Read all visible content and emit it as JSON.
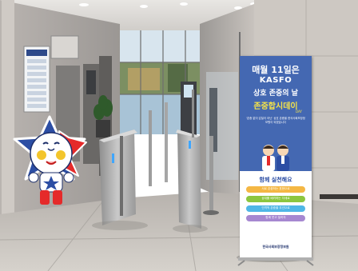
{
  "banner": {
    "line1": "매월 11일은",
    "brand": "KASFO",
    "line3": "상호 존중의 날",
    "highlight": "존중합시데이",
    "day_small": "DAY",
    "intro": "'존중 없이 갑질이 아닌' 상호 존중을 한국사회보장정보원이 되겠습니다",
    "pledge_title": "함께 실천해요",
    "actions": [
      "서로 존중하는 표현으로",
      "상대를 배려하는 자세로",
      "인격적 존중을 우선으로",
      "함께 웃고 일하자"
    ],
    "footer_logo": "한국사회보장정보원"
  },
  "colors": {
    "banner_top": "#3a5fa8",
    "banner_highlight": "#f3e24a",
    "mascot_star": "#2c4ea4",
    "mascot_body": "#e52a2a"
  }
}
